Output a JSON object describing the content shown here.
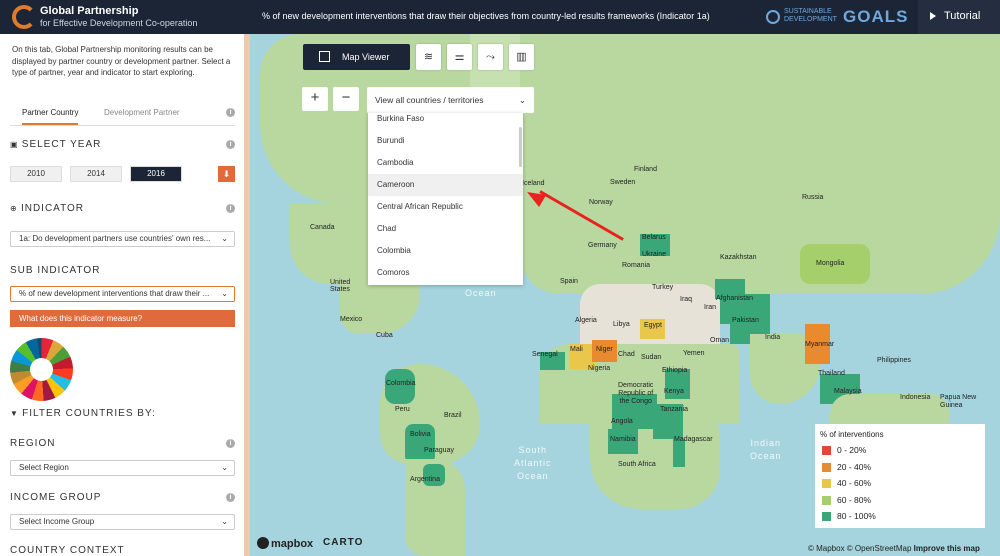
{
  "header": {
    "brand_title": "Global Partnership",
    "brand_subtitle": "for Effective Development Co-operation",
    "page_title": "% of new development interventions that draw their objectives from country-led results frameworks (Indicator 1a)",
    "sdg_line1": "SUSTAINABLE",
    "sdg_line2": "DEVELOPMENT",
    "sdg_goals": "GOALS",
    "tutorial": "Tutorial"
  },
  "sidebar": {
    "intro": "On this tab, Global Partnership monitoring results can be displayed by partner country or development partner. Select a type of partner, year and indicator to start exploring.",
    "tabs": [
      "Partner Country",
      "Development Partner"
    ],
    "select_year_label": "SELECT YEAR",
    "years": [
      "2010",
      "2014",
      "2016"
    ],
    "selected_year": "2016",
    "indicator_label": "INDICATOR",
    "indicator_value": "1a: Do development partners use countries' own res...",
    "sub_indicator_label": "SUB INDICATOR",
    "sub_indicator_value": "% of new development interventions that draw their ...",
    "what_button": "What does this indicator measure?",
    "filter_label": "FILTER COUNTRIES BY:",
    "region_label": "REGION",
    "region_value": "Select Region",
    "income_label": "INCOME GROUP",
    "income_value": "Select Income Group",
    "context_label": "COUNTRY CONTEXT"
  },
  "map": {
    "viewer_label": "Map Viewer",
    "country_select": "View all countries / territories",
    "dropdown_items": [
      "Burkina Faso",
      "Burundi",
      "Cambodia",
      "Cameroon",
      "Central African Republic",
      "Chad",
      "Colombia",
      "Comoros"
    ],
    "highlighted_item": "Cameroon",
    "labels": {
      "canada": "Canada",
      "us": "United\nStates",
      "mexico": "Mexico",
      "cuba": "Cuba",
      "colombia": "Colombia",
      "peru": "Peru",
      "brazil": "Brazil",
      "bolivia": "Bolivia",
      "paraguay": "Paraguay",
      "argentina": "Argentina",
      "iceland": "Iceland",
      "norway": "Norway",
      "sweden": "Sweden",
      "finland": "Finland",
      "russia": "Russia",
      "belarus": "Belarus",
      "ukraine": "Ukraine",
      "germany": "Germany",
      "romania": "Romania",
      "spain": "Spain",
      "turkey": "Turkey",
      "kazakhstan": "Kazakhstan",
      "mongolia": "Mongolia",
      "iraq": "Iraq",
      "iran": "Iran",
      "afghanistan": "Afghanistan",
      "pakistan": "Pakistan",
      "india": "India",
      "oman": "Oman",
      "yemen": "Yemen",
      "libya": "Libya",
      "egypt": "Egypt",
      "algeria": "Algeria",
      "mali": "Mali",
      "niger": "Niger",
      "chad": "Chad",
      "sudan": "Sudan",
      "senegal": "Senegal",
      "nigeria": "Nigeria",
      "ethiopia": "Ethiopia",
      "drc": "Democratic\nRepublic of\nthe Congo",
      "kenya": "Kenya",
      "tanzania": "Tanzania",
      "angola": "Angola",
      "namibia": "Namibia",
      "madagascar": "Madagascar",
      "south_africa": "South Africa",
      "myanmar": "Myanmar",
      "thailand": "Thailand",
      "philippines": "Philippines",
      "malaysia": "Malaysia",
      "indonesia": "Indonesia",
      "papua": "Papua New\nGuinea"
    },
    "oceans": {
      "north_atlantic": "Atlantic\nOcean",
      "south_atlantic": "South\nAtlantic\nOcean",
      "indian": "Indian\nOcean"
    },
    "legend_title": "% of interventions",
    "legend": [
      {
        "label": "0 - 20%",
        "color": "#e0483a"
      },
      {
        "label": "20 - 40%",
        "color": "#ea8a2e"
      },
      {
        "label": "40 - 60%",
        "color": "#e9c74a"
      },
      {
        "label": "60 - 80%",
        "color": "#a5cf6a"
      },
      {
        "label": "80 - 100%",
        "color": "#3aa779"
      }
    ],
    "mapbox": "mapbox",
    "carto": "CARTO",
    "attrib": "© Mapbox © OpenStreetMap",
    "improve": "Improve this map"
  }
}
